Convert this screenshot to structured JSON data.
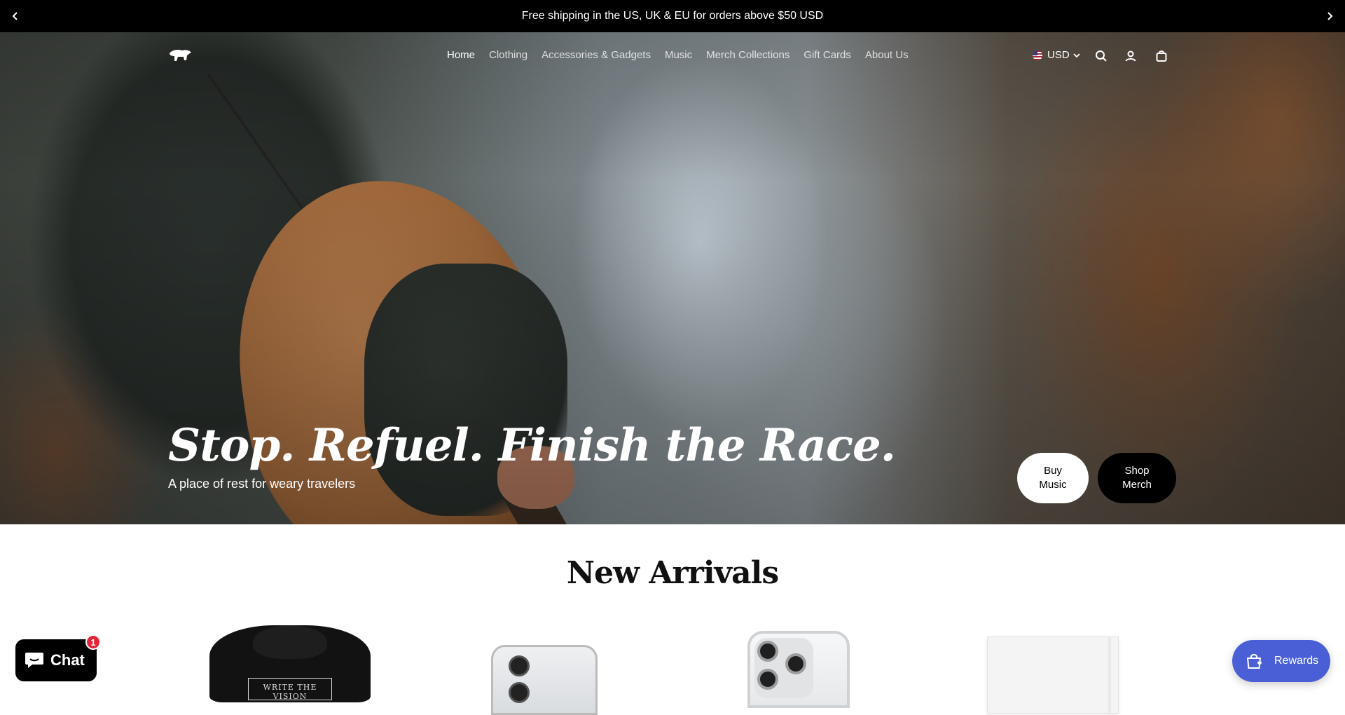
{
  "announcement": {
    "text": "Free shipping in the US, UK & EU for orders above $50 USD"
  },
  "header": {
    "logo_icon": "stylized-animal-logo",
    "nav": [
      {
        "label": "Home",
        "active": true
      },
      {
        "label": "Clothing",
        "active": false
      },
      {
        "label": "Accessories & Gadgets",
        "active": false
      },
      {
        "label": "Music",
        "active": false
      },
      {
        "label": "Merch Collections",
        "active": false
      },
      {
        "label": "Gift Cards",
        "active": false
      },
      {
        "label": "About Us",
        "active": false
      }
    ],
    "currency": "USD",
    "icons": [
      "search-icon",
      "account-icon",
      "cart-icon"
    ]
  },
  "hero": {
    "title": "Stop. Refuel. Finish the Race.",
    "subtitle": "A place of rest for weary travelers",
    "buy_music": {
      "line1": "Buy",
      "line2": "Music"
    },
    "shop_merch": {
      "line1": "Shop",
      "line2": "Merch"
    }
  },
  "new_arrivals": {
    "title": "New Arrivals",
    "hoodie_print": "WRITE THE VISION"
  },
  "chat": {
    "label": "Chat",
    "badge": "1"
  },
  "rewards": {
    "label": "Rewards"
  },
  "colors": {
    "announcement_bg": "#000000",
    "rewards_bg": "#4a5fd6",
    "chat_badge": "#e3263b"
  }
}
